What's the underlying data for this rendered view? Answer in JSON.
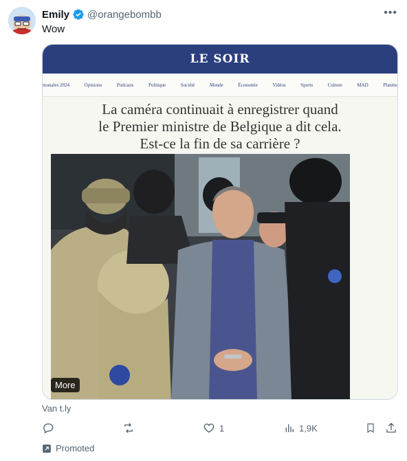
{
  "author": {
    "display_name": "Emily",
    "handle": "@orangebombb",
    "verified_icon": "verified-badge-icon"
  },
  "tweet": {
    "text": "Wow",
    "source": "Van t.ly"
  },
  "card": {
    "masthead": "LE SOIR",
    "nav": [
      "munales 2024",
      "Opinions",
      "Podcasts",
      "Politique",
      "Société",
      "Monde",
      "Économie",
      "Vidéos",
      "Sports",
      "Culture",
      "MAD",
      "Planète"
    ],
    "headline": [
      "La caméra continuait à enregistrer quand",
      "le Premier ministre de Belgique a dit cela.",
      "Est-ce la fin de sa carrière ?"
    ],
    "more_label": "More"
  },
  "actions": {
    "reply_count": "",
    "retweet_count": "",
    "like_count": "1",
    "views_count": "1,9K"
  },
  "promoted_label": "Promoted",
  "colors": {
    "masthead_bg": "#2b3f7f",
    "verified": "#1d9bf0",
    "secondary_text": "#536471"
  }
}
